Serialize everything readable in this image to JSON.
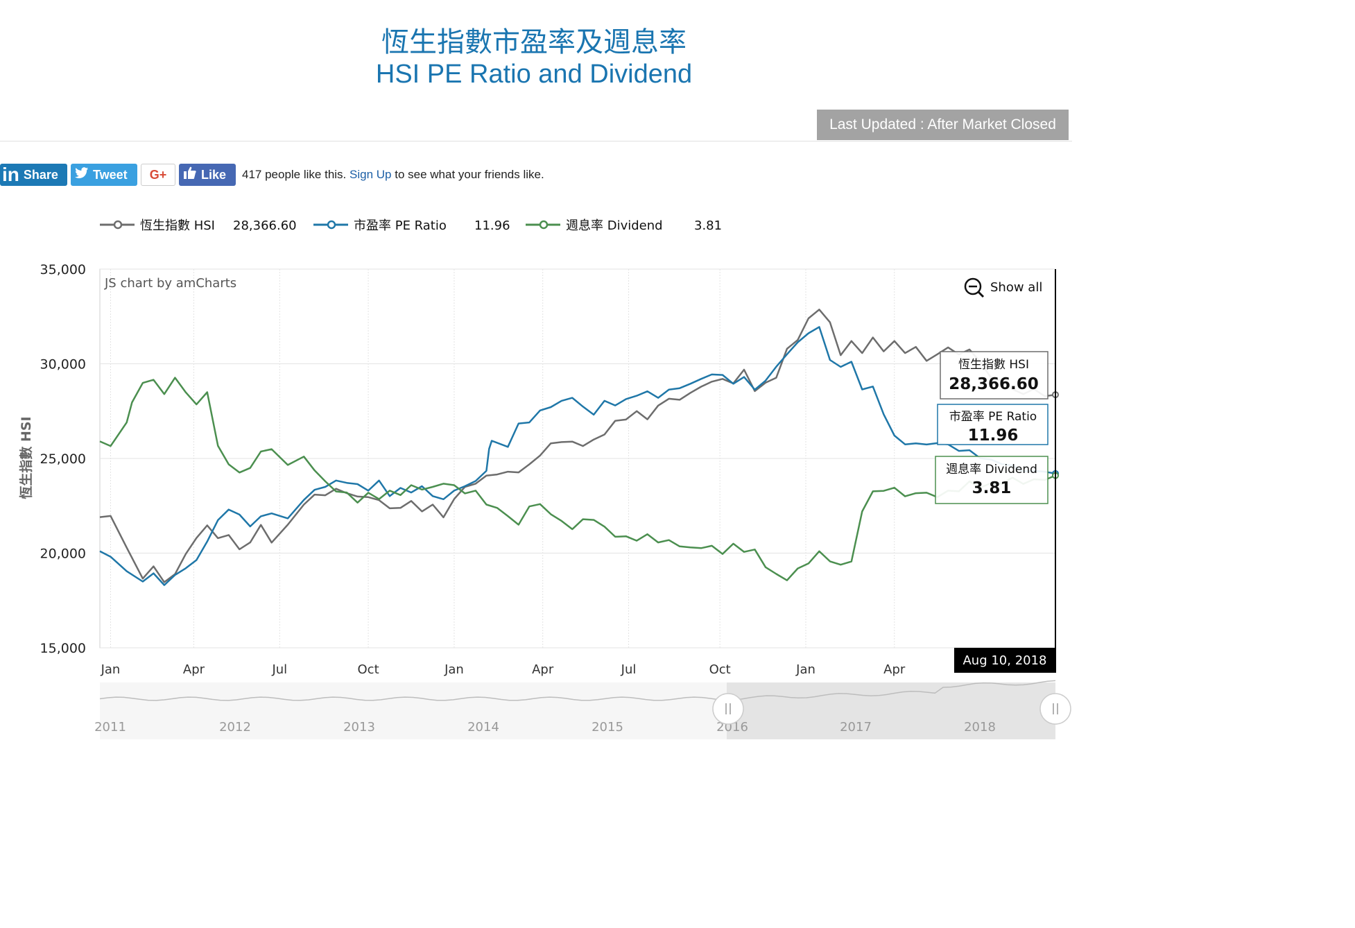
{
  "title": {
    "zh": "恆生指數市盈率及週息率",
    "en": "HSI PE Ratio and Dividend"
  },
  "last_updated": "Last Updated : After Market Closed",
  "social": {
    "linkedin_label": "Share",
    "linkedin_icon": "in",
    "tweet_label": "Tweet",
    "gplus_label": "G+",
    "like_label": "Like",
    "like_count_text": "417 people like this.",
    "signup_link": "Sign Up",
    "signup_suffix": "to see what your friends like."
  },
  "legend": [
    {
      "label": "恆生指數 HSI",
      "value": "28,366.60",
      "color": "#6d6d6d"
    },
    {
      "label": "市盈率 PE Ratio",
      "value": "11.96",
      "color": "#1f77a8"
    },
    {
      "label": "週息率 Dividend",
      "value": "3.81",
      "color": "#4b8f4f"
    }
  ],
  "chart_data": {
    "type": "line",
    "credit": "JS chart by amCharts",
    "show_all_label": "Show all",
    "ylabel": "恆生指數 HSI",
    "ylim": [
      15000,
      35000
    ],
    "y_ticks": [
      "15,000",
      "20,000",
      "25,000",
      "30,000",
      "35,000"
    ],
    "x_ticks": [
      "Jan",
      "Apr",
      "Jul",
      "Oct",
      "Jan",
      "Apr",
      "Jul",
      "Oct",
      "Jan",
      "Apr"
    ],
    "cursor_date": "Aug 10, 2018",
    "grid": true,
    "series": [
      {
        "name": "恆生指數 HSI",
        "color": "#6d6d6d",
        "points": [
          [
            0,
            21900
          ],
          [
            0.02,
            22100
          ],
          [
            0.05,
            20200
          ],
          [
            0.08,
            18700
          ],
          [
            0.1,
            19300
          ],
          [
            0.12,
            18600
          ],
          [
            0.14,
            18800
          ],
          [
            0.16,
            20000
          ],
          [
            0.18,
            20800
          ],
          [
            0.2,
            21600
          ],
          [
            0.22,
            20700
          ],
          [
            0.24,
            21000
          ],
          [
            0.26,
            20200
          ],
          [
            0.28,
            20700
          ],
          [
            0.3,
            21400
          ],
          [
            0.32,
            20600
          ],
          [
            0.35,
            21500
          ],
          [
            0.38,
            22700
          ],
          [
            0.4,
            23000
          ],
          [
            0.42,
            23100
          ],
          [
            0.44,
            23400
          ],
          [
            0.46,
            23300
          ],
          [
            0.48,
            22900
          ],
          [
            0.5,
            23000
          ],
          [
            0.52,
            22800
          ],
          [
            0.54,
            22500
          ],
          [
            0.56,
            22300
          ],
          [
            0.58,
            22800
          ],
          [
            0.6,
            22200
          ],
          [
            0.62,
            22700
          ],
          [
            0.64,
            21800
          ],
          [
            0.66,
            22900
          ],
          [
            0.68,
            23500
          ],
          [
            0.7,
            23800
          ],
          [
            0.72,
            24000
          ],
          [
            0.74,
            24200
          ],
          [
            0.76,
            24300
          ],
          [
            0.78,
            24400
          ],
          [
            0.8,
            24600
          ],
          [
            0.82,
            25200
          ],
          [
            0.84,
            25800
          ],
          [
            0.86,
            26000
          ],
          [
            0.88,
            25800
          ],
          [
            0.9,
            25700
          ],
          [
            0.92,
            26000
          ],
          [
            0.94,
            26400
          ],
          [
            0.96,
            26900
          ],
          [
            0.98,
            27100
          ],
          [
            1.0,
            27500
          ],
          [
            1.02,
            27200
          ],
          [
            1.04,
            27700
          ],
          [
            1.06,
            28200
          ],
          [
            1.08,
            28100
          ],
          [
            1.1,
            28600
          ],
          [
            1.12,
            28700
          ],
          [
            1.14,
            29100
          ],
          [
            1.16,
            29200
          ],
          [
            1.18,
            29100
          ],
          [
            1.2,
            29600
          ],
          [
            1.22,
            28600
          ],
          [
            1.24,
            29000
          ],
          [
            1.26,
            29400
          ],
          [
            1.28,
            30700
          ],
          [
            1.3,
            31300
          ],
          [
            1.32,
            32400
          ],
          [
            1.34,
            33000
          ],
          [
            1.36,
            32100
          ],
          [
            1.38,
            30500
          ],
          [
            1.4,
            31200
          ],
          [
            1.42,
            30700
          ],
          [
            1.44,
            31300
          ],
          [
            1.46,
            30700
          ],
          [
            1.48,
            31200
          ],
          [
            1.5,
            30700
          ],
          [
            1.52,
            30800
          ],
          [
            1.54,
            30200
          ],
          [
            1.56,
            30500
          ],
          [
            1.58,
            31000
          ],
          [
            1.6,
            30400
          ],
          [
            1.62,
            30800
          ],
          [
            1.64,
            30100
          ],
          [
            1.66,
            29400
          ],
          [
            1.68,
            29000
          ],
          [
            1.7,
            28700
          ],
          [
            1.72,
            28400
          ],
          [
            1.74,
            28800
          ],
          [
            1.76,
            28200
          ],
          [
            1.78,
            28367
          ]
        ]
      },
      {
        "name": "市盈率 PE Ratio",
        "color": "#1f77a8",
        "points": [
          [
            0,
            20100
          ],
          [
            0.02,
            19900
          ],
          [
            0.05,
            19000
          ],
          [
            0.08,
            18500
          ],
          [
            0.1,
            18800
          ],
          [
            0.12,
            18400
          ],
          [
            0.14,
            18800
          ],
          [
            0.16,
            19200
          ],
          [
            0.18,
            19500
          ],
          [
            0.2,
            20700
          ],
          [
            0.22,
            21700
          ],
          [
            0.24,
            22300
          ],
          [
            0.26,
            21900
          ],
          [
            0.28,
            21500
          ],
          [
            0.3,
            21900
          ],
          [
            0.32,
            22100
          ],
          [
            0.35,
            21700
          ],
          [
            0.38,
            22900
          ],
          [
            0.4,
            23300
          ],
          [
            0.42,
            23500
          ],
          [
            0.44,
            23700
          ],
          [
            0.46,
            23800
          ],
          [
            0.48,
            23600
          ],
          [
            0.5,
            23300
          ],
          [
            0.52,
            23700
          ],
          [
            0.54,
            23100
          ],
          [
            0.56,
            23400
          ],
          [
            0.58,
            23200
          ],
          [
            0.6,
            23400
          ],
          [
            0.62,
            23100
          ],
          [
            0.64,
            22800
          ],
          [
            0.66,
            23300
          ],
          [
            0.68,
            23400
          ],
          [
            0.7,
            23900
          ],
          [
            0.72,
            24300
          ],
          [
            0.725,
            25500
          ],
          [
            0.73,
            25800
          ],
          [
            0.76,
            25700
          ],
          [
            0.78,
            26800
          ],
          [
            0.8,
            26900
          ],
          [
            0.82,
            27400
          ],
          [
            0.84,
            27800
          ],
          [
            0.86,
            28000
          ],
          [
            0.88,
            28200
          ],
          [
            0.9,
            27600
          ],
          [
            0.92,
            27400
          ],
          [
            0.94,
            28000
          ],
          [
            0.96,
            27800
          ],
          [
            0.98,
            28000
          ],
          [
            1.0,
            28400
          ],
          [
            1.02,
            28500
          ],
          [
            1.04,
            28200
          ],
          [
            1.06,
            28500
          ],
          [
            1.08,
            28800
          ],
          [
            1.1,
            28900
          ],
          [
            1.12,
            29200
          ],
          [
            1.14,
            29300
          ],
          [
            1.16,
            29500
          ],
          [
            1.18,
            28900
          ],
          [
            1.2,
            29300
          ],
          [
            1.22,
            28500
          ],
          [
            1.24,
            29200
          ],
          [
            1.26,
            29800
          ],
          [
            1.28,
            30500
          ],
          [
            1.3,
            31000
          ],
          [
            1.32,
            31700
          ],
          [
            1.34,
            31900
          ],
          [
            1.36,
            30200
          ],
          [
            1.38,
            29700
          ],
          [
            1.4,
            30200
          ],
          [
            1.42,
            28600
          ],
          [
            1.44,
            28800
          ],
          [
            1.46,
            27200
          ],
          [
            1.48,
            26300
          ],
          [
            1.5,
            25700
          ],
          [
            1.52,
            25800
          ],
          [
            1.54,
            25600
          ],
          [
            1.56,
            25900
          ],
          [
            1.58,
            25700
          ],
          [
            1.6,
            25400
          ],
          [
            1.62,
            25300
          ],
          [
            1.64,
            25100
          ],
          [
            1.66,
            24900
          ],
          [
            1.68,
            24700
          ],
          [
            1.7,
            24500
          ],
          [
            1.72,
            24400
          ],
          [
            1.74,
            24300
          ],
          [
            1.76,
            24300
          ],
          [
            1.78,
            24200
          ]
        ]
      },
      {
        "name": "週息率 Dividend",
        "color": "#4b8f4f",
        "points": [
          [
            0,
            25900
          ],
          [
            0.02,
            25700
          ],
          [
            0.05,
            26900
          ],
          [
            0.06,
            28100
          ],
          [
            0.08,
            28900
          ],
          [
            0.1,
            29200
          ],
          [
            0.12,
            28400
          ],
          [
            0.14,
            29400
          ],
          [
            0.16,
            28400
          ],
          [
            0.18,
            27900
          ],
          [
            0.2,
            28500
          ],
          [
            0.22,
            25800
          ],
          [
            0.24,
            24600
          ],
          [
            0.26,
            24300
          ],
          [
            0.28,
            24500
          ],
          [
            0.3,
            25500
          ],
          [
            0.32,
            25400
          ],
          [
            0.35,
            24700
          ],
          [
            0.38,
            25100
          ],
          [
            0.4,
            24500
          ],
          [
            0.42,
            23700
          ],
          [
            0.44,
            23300
          ],
          [
            0.46,
            23200
          ],
          [
            0.48,
            22800
          ],
          [
            0.5,
            23100
          ],
          [
            0.52,
            22900
          ],
          [
            0.54,
            23300
          ],
          [
            0.56,
            23200
          ],
          [
            0.58,
            23500
          ],
          [
            0.6,
            23400
          ],
          [
            0.62,
            23500
          ],
          [
            0.64,
            23800
          ],
          [
            0.66,
            23500
          ],
          [
            0.68,
            23200
          ],
          [
            0.7,
            23300
          ],
          [
            0.72,
            22700
          ],
          [
            0.74,
            22300
          ],
          [
            0.76,
            22000
          ],
          [
            0.78,
            21500
          ],
          [
            0.8,
            22600
          ],
          [
            0.82,
            22500
          ],
          [
            0.84,
            22100
          ],
          [
            0.86,
            21700
          ],
          [
            0.88,
            21400
          ],
          [
            0.9,
            21700
          ],
          [
            0.92,
            21800
          ],
          [
            0.94,
            21400
          ],
          [
            0.96,
            21000
          ],
          [
            0.98,
            20800
          ],
          [
            1.0,
            20700
          ],
          [
            1.02,
            21000
          ],
          [
            1.04,
            20700
          ],
          [
            1.06,
            20600
          ],
          [
            1.08,
            20400
          ],
          [
            1.1,
            20300
          ],
          [
            1.12,
            20400
          ],
          [
            1.14,
            20300
          ],
          [
            1.16,
            20000
          ],
          [
            1.18,
            20500
          ],
          [
            1.2,
            20200
          ],
          [
            1.22,
            20100
          ],
          [
            1.24,
            19300
          ],
          [
            1.26,
            18900
          ],
          [
            1.28,
            18700
          ],
          [
            1.3,
            19100
          ],
          [
            1.32,
            19500
          ],
          [
            1.34,
            20100
          ],
          [
            1.36,
            19700
          ],
          [
            1.38,
            19300
          ],
          [
            1.4,
            19600
          ],
          [
            1.42,
            22200
          ],
          [
            1.44,
            23400
          ],
          [
            1.46,
            23200
          ],
          [
            1.48,
            23500
          ],
          [
            1.5,
            23000
          ],
          [
            1.52,
            23300
          ],
          [
            1.54,
            23100
          ],
          [
            1.56,
            23000
          ],
          [
            1.58,
            23300
          ],
          [
            1.6,
            23400
          ],
          [
            1.62,
            23700
          ],
          [
            1.64,
            23500
          ],
          [
            1.66,
            23700
          ],
          [
            1.68,
            23800
          ],
          [
            1.7,
            23900
          ],
          [
            1.72,
            23700
          ],
          [
            1.74,
            23900
          ],
          [
            1.76,
            24000
          ],
          [
            1.78,
            24100
          ]
        ]
      }
    ],
    "tooltips": [
      {
        "label": "恆生指數 HSI",
        "value": "28,366.60"
      },
      {
        "label": "市盈率 PE Ratio",
        "value": "11.96"
      },
      {
        "label": "週息率 Dividend",
        "value": "3.81"
      }
    ],
    "navigator_years": [
      "2011",
      "2012",
      "2013",
      "2014",
      "2015",
      "2016",
      "2017",
      "2018"
    ]
  }
}
